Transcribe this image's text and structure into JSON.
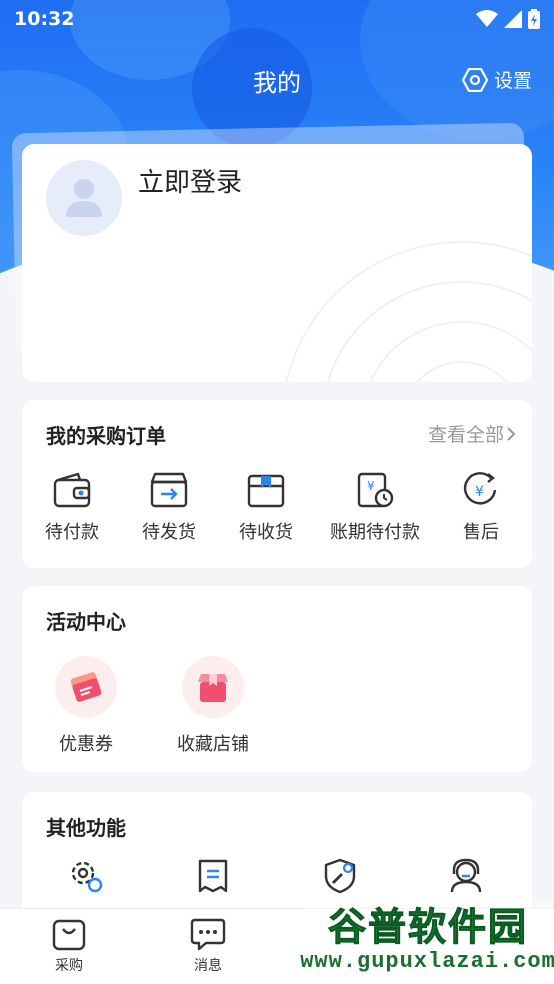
{
  "status_bar": {
    "time": "10:32"
  },
  "header": {
    "title": "我的",
    "settings_label": "设置"
  },
  "profile": {
    "login_text": "立即登录"
  },
  "orders": {
    "title": "我的采购订单",
    "view_all": "查看全部",
    "items": [
      {
        "label": "待付款",
        "icon": "wallet-icon"
      },
      {
        "label": "待发货",
        "icon": "ship-box-icon"
      },
      {
        "label": "待收货",
        "icon": "receive-box-icon"
      },
      {
        "label": "账期待付款",
        "icon": "billing-period-icon"
      },
      {
        "label": "售后",
        "icon": "after-sale-icon"
      }
    ]
  },
  "activity": {
    "title": "活动中心",
    "items": [
      {
        "label": "优惠券",
        "icon": "coupon-icon"
      },
      {
        "label": "收藏店铺",
        "icon": "favorite-store-icon"
      }
    ]
  },
  "others": {
    "title": "其他功能",
    "items": [
      {
        "icon": "settings-user-icon"
      },
      {
        "icon": "receipt-icon"
      },
      {
        "icon": "shield-tool-icon"
      },
      {
        "icon": "customer-service-icon"
      }
    ]
  },
  "tab_bar": {
    "items": [
      {
        "label": "采购",
        "icon": "shopping-bag-icon"
      },
      {
        "label": "消息",
        "icon": "message-icon"
      }
    ]
  },
  "watermark": {
    "title": "谷普软件园",
    "url": "www.gupuxlazai.com"
  },
  "colors": {
    "primary": "#1f6df3",
    "accent_red": "#f0506e",
    "text_gray": "#999999"
  }
}
